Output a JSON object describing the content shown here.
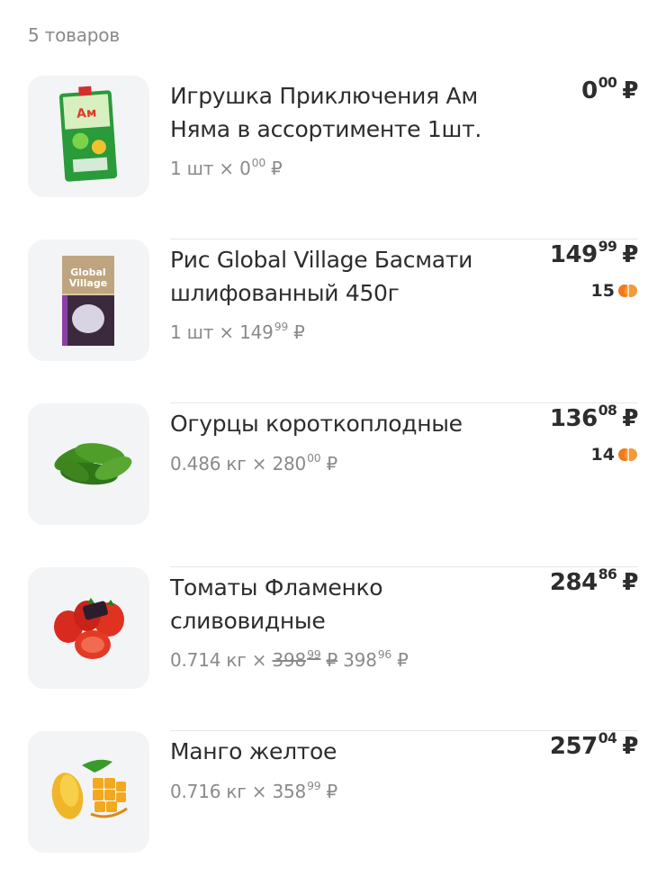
{
  "header": {
    "count": "5 товаров"
  },
  "colors": {
    "bonus": "#f07a1a",
    "price": "#2d2d2d",
    "muted": "#8a8a8a"
  },
  "items": [
    {
      "image": "toy-pack-image",
      "name": "Игрушка Приключения Ам Няма в ассортименте 1шт.",
      "qty_prefix": "1 шт × 0",
      "qty_unit_kop": "00",
      "qty_old": "",
      "qty_old_kop": "",
      "qty_new": "",
      "qty_new_kop": "",
      "price_rub": "0",
      "price_kop": "00",
      "currency": "₽",
      "bonus": ""
    },
    {
      "image": "rice-pack-image",
      "name": "Рис Global Village Басмати шлифованный 450г",
      "qty_prefix": "1 шт × 149",
      "qty_unit_kop": "99",
      "price_rub": "149",
      "price_kop": "99",
      "currency": "₽",
      "bonus": "15"
    },
    {
      "image": "cucumbers-image",
      "name": "Огурцы короткоплодные",
      "qty_prefix": "0.486 кг × 280",
      "qty_unit_kop": "00",
      "price_rub": "136",
      "price_kop": "08",
      "currency": "₽",
      "bonus": "14"
    },
    {
      "image": "tomatoes-image",
      "name": "Томаты Фламенко сливовидные",
      "qty_prefix": "0.714 кг ×",
      "qty_old": "398",
      "qty_old_kop": "99",
      "qty_new": "398",
      "qty_new_kop": "96",
      "price_rub": "284",
      "price_kop": "86",
      "currency": "₽",
      "bonus": ""
    },
    {
      "image": "mango-image",
      "name": "Манго желтое",
      "qty_prefix": "0.716 кг × 358",
      "qty_unit_kop": "99",
      "price_rub": "257",
      "price_kop": "04",
      "currency": "₽",
      "bonus": ""
    }
  ]
}
